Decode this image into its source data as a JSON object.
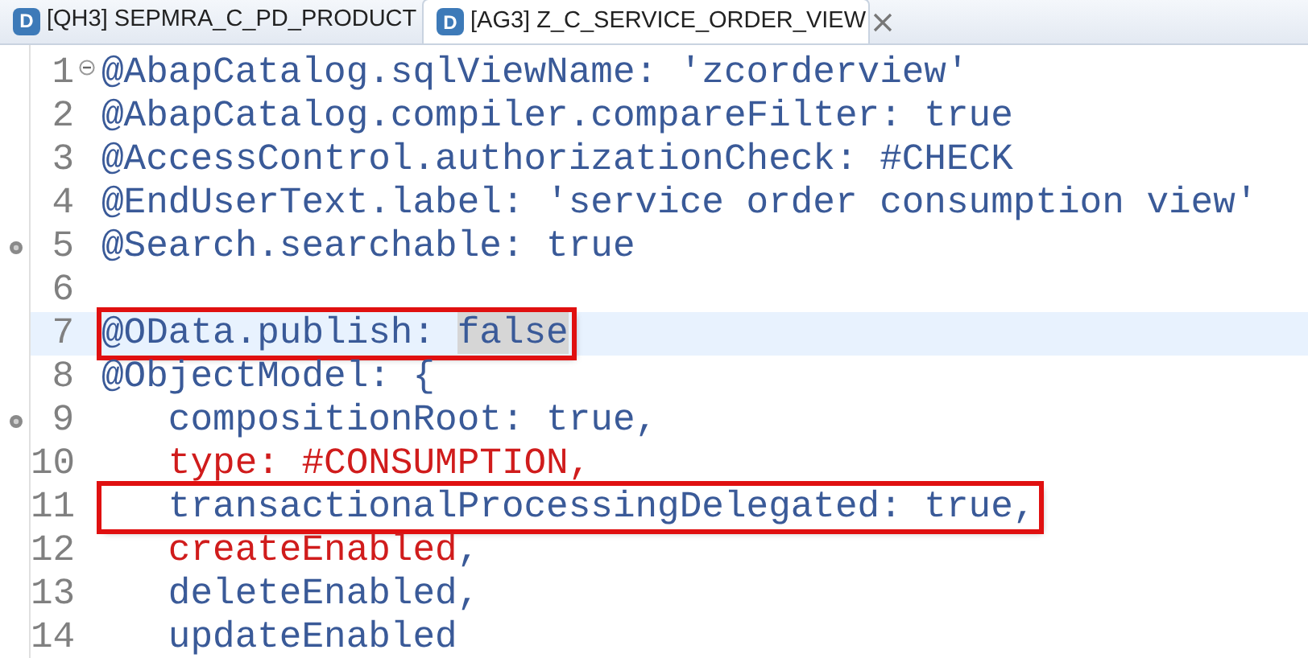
{
  "tabs": [
    {
      "icon_letter": "D",
      "system": "[QH3]",
      "label": "SEPMRA_C_PD_PRODUCT",
      "selected": false,
      "closable": false
    },
    {
      "icon_letter": "D",
      "system": "[AG3]",
      "label": "Z_C_SERVICE_ORDER_VIEW",
      "selected": true,
      "closable": true
    }
  ],
  "lines": [
    {
      "number": "1",
      "collapsible": true,
      "segments": [
        {
          "text": "@AbapCatalog.sqlViewName: 'zcorderview'",
          "kind": "plain"
        }
      ]
    },
    {
      "number": "2",
      "segments": [
        {
          "text": "@AbapCatalog.compiler.compareFilter: true",
          "kind": "plain"
        }
      ]
    },
    {
      "number": "3",
      "segments": [
        {
          "text": "@AccessControl.authorizationCheck: #CHECK",
          "kind": "plain"
        }
      ]
    },
    {
      "number": "4",
      "segments": [
        {
          "text": "@EndUserText.label: 'service order consumption view'",
          "kind": "plain"
        }
      ]
    },
    {
      "number": "5",
      "annotated": true,
      "segments": [
        {
          "text": "@Search.searchable: true",
          "kind": "plain"
        }
      ]
    },
    {
      "number": "6"
    },
    {
      "number": "7",
      "current": true,
      "boxed": true,
      "segments": [
        {
          "text": "@OData.publish: ",
          "kind": "plain"
        },
        {
          "text": "false",
          "kind": "plain",
          "marked": true
        }
      ]
    },
    {
      "number": "8",
      "segments": [
        {
          "text": "@ObjectModel: {",
          "kind": "plain"
        }
      ]
    },
    {
      "number": "9",
      "annotated": true,
      "segments": [
        {
          "text": "   compositionRoot: true,",
          "kind": "plain"
        }
      ]
    },
    {
      "number": "10",
      "segments": [
        {
          "text": "   type: #CONSUMPTION,",
          "kind": "keyword"
        }
      ]
    },
    {
      "number": "11",
      "boxed": true,
      "segments": [
        {
          "text": "   transactionalProcessingDelegated: true,",
          "kind": "plain"
        }
      ]
    },
    {
      "number": "12",
      "segments": [
        {
          "text": "   createEnabled",
          "kind": "keyword"
        },
        {
          "text": ",",
          "kind": "plain"
        }
      ]
    },
    {
      "number": "13",
      "segments": [
        {
          "text": "   deleteEnabled,",
          "kind": "plain"
        }
      ]
    },
    {
      "number": "14",
      "segments": [
        {
          "text": "   updateEnabled",
          "kind": "plain"
        }
      ]
    }
  ]
}
